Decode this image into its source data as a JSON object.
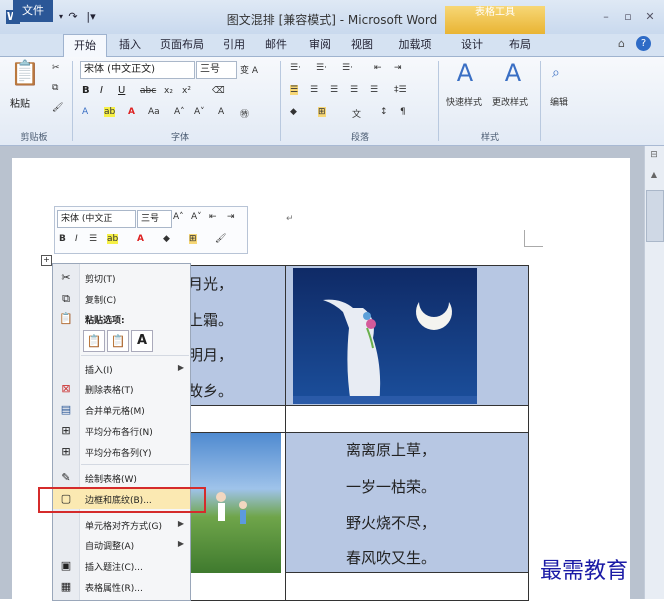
{
  "title": "图文混排 [兼容模式] - Microsoft Word",
  "tools_header": "表格工具",
  "tabs": [
    "文件",
    "开始",
    "插入",
    "页面布局",
    "引用",
    "邮件",
    "审阅",
    "视图",
    "加载项",
    "设计",
    "布局"
  ],
  "ribbon": {
    "paste": "粘贴",
    "font_name": "宋体 (中文正文)",
    "font_size": "三号",
    "quick_styles": "快速样式",
    "change_styles": "更改样式",
    "edit": "编辑",
    "groups": [
      "剪贴板",
      "字体",
      "段落",
      "样式"
    ]
  },
  "minitoolbar": {
    "font_name": "宋体 (中文正",
    "font_size": "三号"
  },
  "poem_left": [
    "月光，",
    "上霜。",
    "明月，",
    "故乡。"
  ],
  "poem_right": [
    "离离原上草，",
    "一岁一枯荣。",
    "野火烧不尽，",
    "春风吹又生。"
  ],
  "menu": {
    "cut": "剪切(T)",
    "copy": "复制(C)",
    "paste_options": "粘贴选项:",
    "insert": "插入(I)",
    "delete_table": "删除表格(T)",
    "merge_cells": "合并单元格(M)",
    "distribute_rows": "平均分布各行(N)",
    "distribute_cols": "平均分布各列(Y)",
    "draw_table": "绘制表格(W)",
    "borders": "边框和底纹(B)...",
    "cell_alignment": "单元格对齐方式(G)",
    "autofit": "自动调整(A)",
    "insert_caption": "插入题注(C)...",
    "table_props": "表格属性(R)..."
  },
  "watermark": "最需教育"
}
